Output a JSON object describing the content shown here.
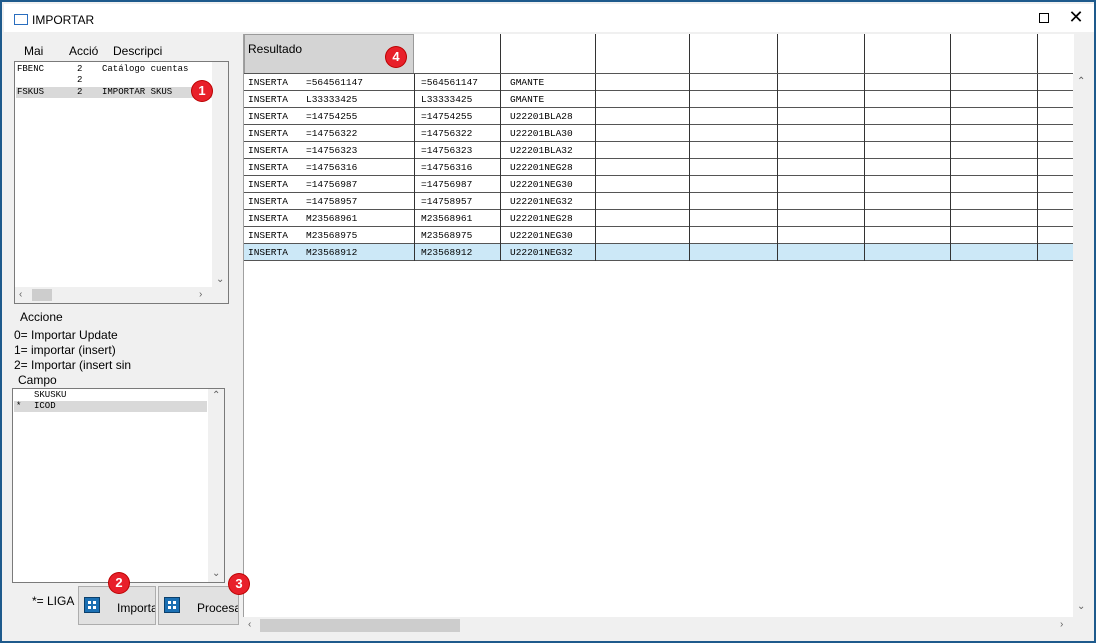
{
  "window": {
    "title": "IMPORTAR"
  },
  "tables_list": {
    "headers": {
      "name": "Mai",
      "action": "Acció",
      "description": "Descripci"
    },
    "rows": [
      {
        "name": "FBENC",
        "action": "2",
        "description": "Catálogo cuentas"
      },
      {
        "name": "",
        "action": "2",
        "description": ""
      },
      {
        "name": "FSKUS",
        "action": "2",
        "description": "IMPORTAR SKUS"
      }
    ]
  },
  "acciones": {
    "title": "Accione",
    "lines": [
      "0= Importar Update",
      "1= importar (insert)",
      "2= Importar (insert sin"
    ]
  },
  "campo": {
    "title": "Campo",
    "rows": [
      {
        "mark": "",
        "value": "SKUSKU"
      },
      {
        "mark": "*",
        "value": "ICOD"
      }
    ]
  },
  "liga_label": "*= LIGA",
  "buttons": {
    "importar": "Importar",
    "procesar": "Procesar"
  },
  "badges": [
    "1",
    "2",
    "3",
    "4"
  ],
  "grid": {
    "header": "Resultado",
    "rows": [
      [
        "INSERTA",
        "=564561147",
        "=564561147",
        "GMANTE"
      ],
      [
        "INSERTA",
        "L33333425",
        "L33333425",
        "GMANTE"
      ],
      [
        "INSERTA",
        "=14754255",
        "=14754255",
        "U22201BLA28"
      ],
      [
        "INSERTA",
        "=14756322",
        "=14756322",
        "U22201BLA30"
      ],
      [
        "INSERTA",
        "=14756323",
        "=14756323",
        "U22201BLA32"
      ],
      [
        "INSERTA",
        "=14756316",
        "=14756316",
        "U22201NEG28"
      ],
      [
        "INSERTA",
        "=14756987",
        "=14756987",
        "U22201NEG30"
      ],
      [
        "INSERTA",
        "=14758957",
        "=14758957",
        "U22201NEG32"
      ],
      [
        "INSERTA",
        "M23568961",
        "M23568961",
        "U22201NEG28"
      ],
      [
        "INSERTA",
        "M23568975",
        "M23568975",
        "U22201NEG30"
      ],
      [
        "INSERTA",
        "M23568912",
        "M23568912",
        "U22201NEG32"
      ]
    ]
  },
  "colors": {
    "badge": "#e8202a",
    "selected_row": "#cce8f7",
    "frame": "#1e5a8c"
  }
}
